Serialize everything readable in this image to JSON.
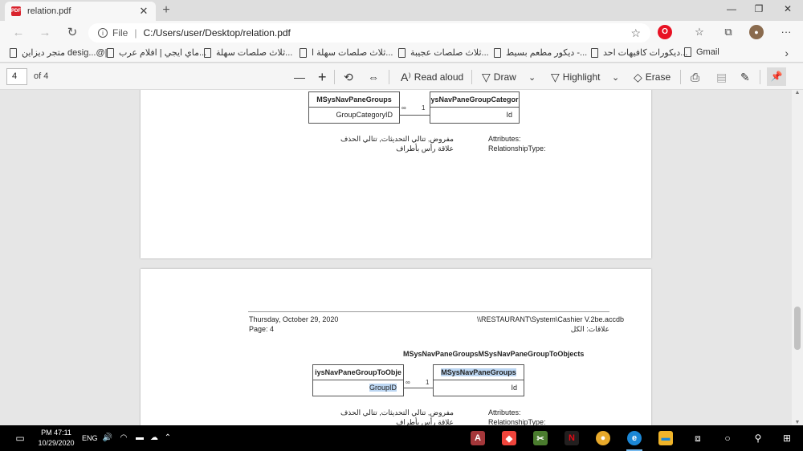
{
  "tab": {
    "title": "relation.pdf",
    "favicon_text": "PDF",
    "close": "✕"
  },
  "window": {
    "new_tab": "+",
    "minimize": "—",
    "maximize": "❐",
    "close": "✕"
  },
  "nav": {
    "back": "←",
    "forward": "→",
    "refresh": "↻",
    "info": "i",
    "file_label": "File",
    "separator": "|",
    "url": "C:/Users/user/Desktop/relation.pdf",
    "star": "☆",
    "more": "···"
  },
  "bookmarks": {
    "items": [
      {
        "label": "Gmail"
      },
      {
        "label": "ديكورات كافيهات احد..."
      },
      {
        "label": "ديكور مطعم بسيط -..."
      },
      {
        "label": "ثلاث صلصات عجيبة..."
      },
      {
        "label": "ثلاث صلصات سهلة ا..."
      },
      {
        "label": "ثلاث صلصات سهلة..."
      },
      {
        "label": "ماي ايجي | افلام عرب..."
      },
      {
        "label": "متجر ديزاين desig...@|"
      }
    ],
    "more": "›"
  },
  "pdf_toolbar": {
    "page_number": "4",
    "page_of": "of 4",
    "zoom_out": "—",
    "zoom_in": "+",
    "rotate": "⟲",
    "fit": "⇔",
    "read_aloud": "Read aloud",
    "draw": "Draw",
    "highlight": "Highlight",
    "erase": "Erase",
    "print": "⎙",
    "save": "▤",
    "save_as": "✎",
    "pin": "📌"
  },
  "page1": {
    "left_table": {
      "title": "MSysNavPaneGroups",
      "field": "GroupCategoryID"
    },
    "right_table": {
      "title": "ysNavPaneGroupCategor",
      "field": "Id"
    },
    "rel_many": "∞",
    "rel_one": "1",
    "attributes_label": "Attributes:",
    "attributes_value": "مفروض, تتالي التحديثات, تتالي الحذف",
    "reltype_label": "RelationshipType:",
    "reltype_value": "علاقة رأس بأطراف"
  },
  "page2": {
    "date": "Thursday, October 29, 2020",
    "page_label": "Page: 4",
    "db_path": "\\\\RESTAURANT\\System\\Cashier V.2be.accdb",
    "relations_label": "علاقات: الكل",
    "relation_title": "MSysNavPaneGroupsMSysNavPaneGroupToObjects",
    "left_table": {
      "title": "iysNavPaneGroupToObje",
      "field": "GroupID"
    },
    "right_table": {
      "title": "MSysNavPaneGroups",
      "field": "Id"
    },
    "rel_many": "∞",
    "rel_one": "1",
    "attributes_label": "Attributes:",
    "attributes_value": "مفروض, تتالي التحديثات, تتالي الحذف",
    "reltype_label": "RelationshipType:",
    "reltype_value": "علاقة رأس بأطراف"
  },
  "taskbar": {
    "time": "PM 47:11",
    "date": "10/29/2020",
    "lang": "ENG",
    "apps": [
      {
        "name": "access",
        "label": "A",
        "color": "#a4373a"
      },
      {
        "name": "anydesk",
        "label": "◆",
        "color": "#ef443b"
      },
      {
        "name": "snip",
        "label": "✂",
        "color": "#4a7c2e"
      },
      {
        "name": "netflix",
        "label": "N",
        "color": "#e50914"
      },
      {
        "name": "chrome",
        "label": "●",
        "color": "#e8a92a"
      },
      {
        "name": "edge",
        "label": "e",
        "color": "#1b87d6"
      },
      {
        "name": "explorer",
        "label": "▬",
        "color": "#f0b429"
      }
    ]
  }
}
